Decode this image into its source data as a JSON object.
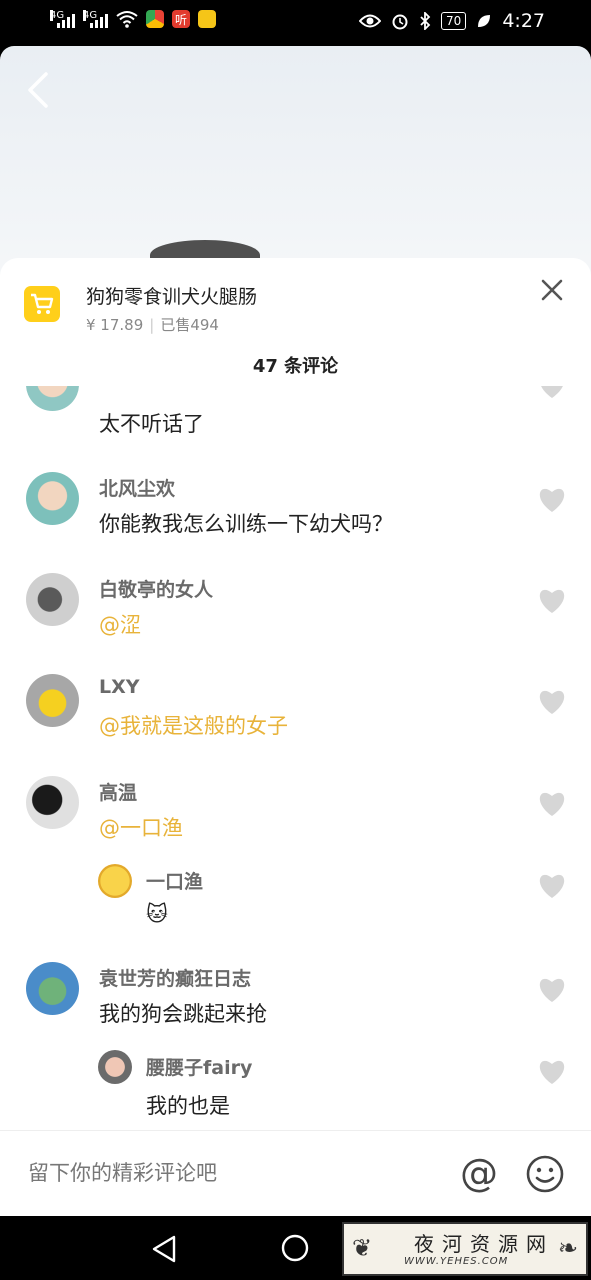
{
  "status_bar": {
    "signal1": "4G",
    "signal2": "4G",
    "app_badge": "听",
    "battery": "70",
    "time": "4:27"
  },
  "product": {
    "title": "狗狗零食训犬火腿肠",
    "price": "¥ 17.89",
    "sold": "已售494"
  },
  "comment_count": "47 条评论",
  "comments": [
    {
      "user": "",
      "text": "太不听话了"
    },
    {
      "user": "北风尘欢",
      "text": "你能教我怎么训练一下幼犬吗？"
    },
    {
      "user": "白敬亭的女人",
      "text": "@涩"
    },
    {
      "user": "LXY",
      "text": "@我就是这般的女子"
    },
    {
      "user": "高温",
      "text": "@一口渔"
    },
    {
      "user": "一口渔",
      "text": "🐱"
    },
    {
      "user": "袁世芳的癫狂日志",
      "text": "我的狗会跳起来抢"
    },
    {
      "user": "腰腰子fairy",
      "text": "我的也是"
    }
  ],
  "input": {
    "placeholder": "留下你的精彩评论吧"
  },
  "watermark": {
    "title": "夜河资源网",
    "url": "WWW.YEHES.COM"
  },
  "colors": {
    "accent_yellow": "#ffcf1a",
    "mention": "#e8b33a",
    "heart": "#d6d6d6"
  }
}
